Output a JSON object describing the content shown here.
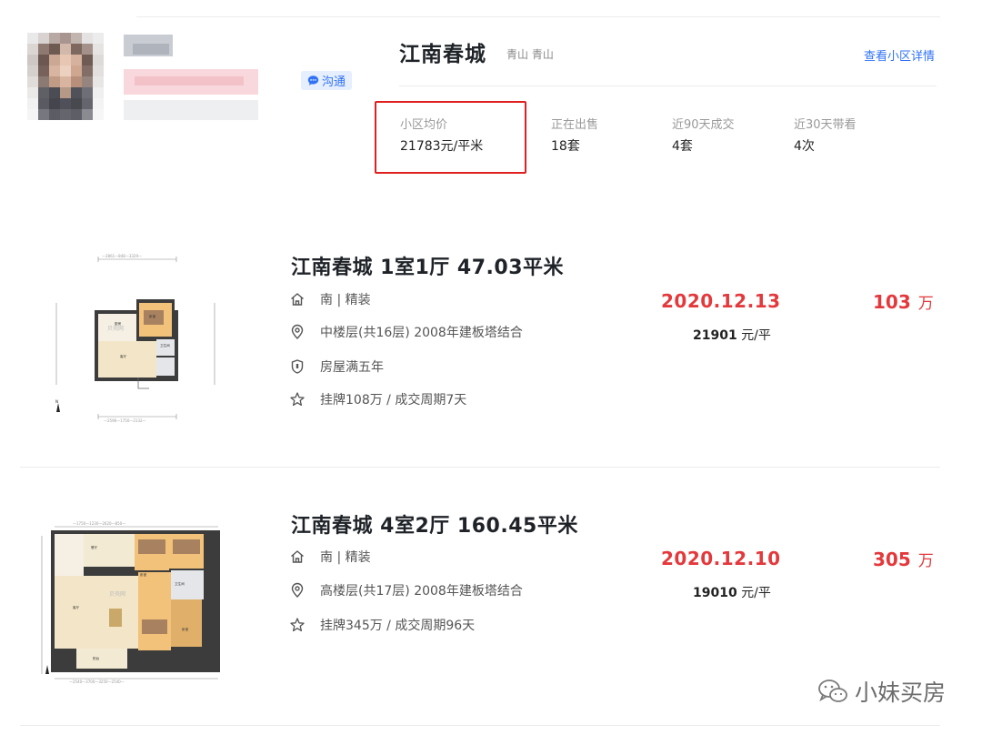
{
  "community": {
    "name": "江南春城",
    "area": "青山 青山",
    "detail_link": "查看小区详情",
    "chat_button": "沟通",
    "stats": [
      {
        "label": "小区均价",
        "value": "21783元/平米"
      },
      {
        "label": "正在出售",
        "value": "18套"
      },
      {
        "label": "近90天成交",
        "value": "4套"
      },
      {
        "label": "近30天带看",
        "value": "4次"
      }
    ]
  },
  "listings": [
    {
      "title": "江南春城 1室1厅 47.03平米",
      "orientation": "南 | 精装",
      "floor": "中楼层(共16层) 2008年建板塔结合",
      "tag": "房屋满五年",
      "deal": "挂牌108万 / 成交周期7天",
      "date": "2020.12.13",
      "unit_price": "21901",
      "unit_price_suffix": "元/平",
      "total": "103",
      "total_unit": "万"
    },
    {
      "title": "江南春城 4室2厅 160.45平米",
      "orientation": "南 | 精装",
      "floor": "高楼层(共17层) 2008年建板塔结合",
      "deal": "挂牌345万 / 成交周期96天",
      "date": "2020.12.10",
      "unit_price": "19010",
      "unit_price_suffix": "元/平",
      "total": "305",
      "total_unit": "万"
    }
  ],
  "watermark": "小妹买房",
  "colors": {
    "accent_blue": "#3072f6",
    "price_red": "#e4393c",
    "highlight": "#e02020"
  }
}
